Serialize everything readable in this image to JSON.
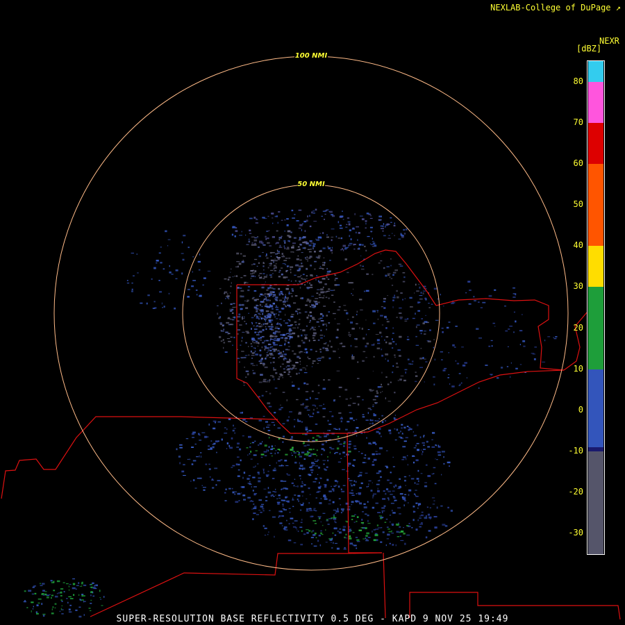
{
  "credit": "NEXLAB-College of DuPage",
  "credit_icon": "external-link-icon",
  "product_code": "NEXR",
  "units": "[dBZ]",
  "range_rings": [
    {
      "label": "50 NMI",
      "nmi": 50
    },
    {
      "label": "100 NMI",
      "nmi": 100
    }
  ],
  "scale_ticks": [
    "80",
    "70",
    "60",
    "50",
    "40",
    "30",
    "20",
    "10",
    "0",
    "-10",
    "-20",
    "-30"
  ],
  "scale_colors": [
    {
      "from": -35,
      "to": -10,
      "color": "#55556a"
    },
    {
      "from": -10,
      "to": -9,
      "color": "#1a1a6e"
    },
    {
      "from": -9,
      "to": 10,
      "color": "#3355bb"
    },
    {
      "from": 10,
      "to": 30,
      "color": "#1e9e3a"
    },
    {
      "from": 30,
      "to": 40,
      "color": "#ffdd00"
    },
    {
      "from": 40,
      "to": 60,
      "color": "#ff5500"
    },
    {
      "from": 60,
      "to": 70,
      "color": "#dd0000"
    },
    {
      "from": 70,
      "to": 80,
      "color": "#ff55dd"
    },
    {
      "from": 80,
      "to": 85,
      "color": "#33ccee"
    }
  ],
  "footer": "SUPER-RESOLUTION BASE REFLECTIVITY 0.5 DEG - KAPD 9 NOV 25 19:49",
  "colors": {
    "ring": "#ffbb88",
    "border": "#dd1111",
    "label": "#ffff33"
  }
}
